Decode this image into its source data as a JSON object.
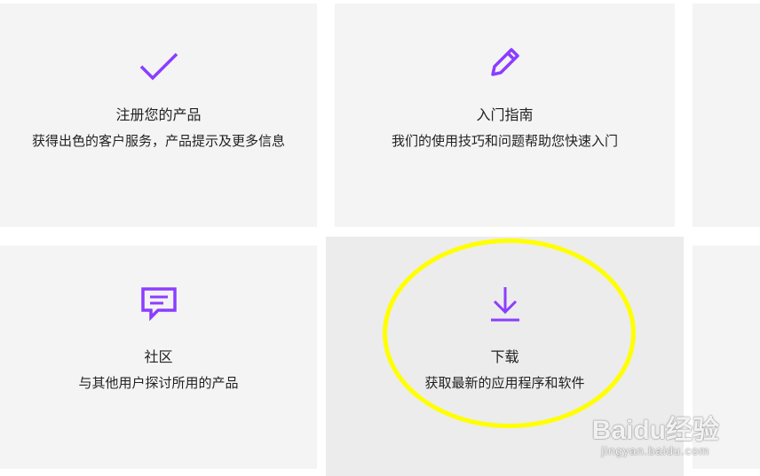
{
  "accent_color": "#8b3dff",
  "highlight_color": "#ffff00",
  "cards": [
    {
      "icon": "checkmark-icon",
      "title": "注册您的产品",
      "description": "获得出色的客户服务，产品提示及更多信息"
    },
    {
      "icon": "pencil-icon",
      "title": "入门指南",
      "description": "我们的使用技巧和问题帮助您快速入门"
    },
    {
      "icon": "chat-bubble-icon",
      "title": "社区",
      "description": "与其他用户探讨所用的产品"
    },
    {
      "icon": "download-icon",
      "title": "下载",
      "description": "获取最新的应用程序和软件"
    }
  ],
  "watermark": {
    "logo": "Baidu经验",
    "url": "jingyan.baidu.com"
  }
}
